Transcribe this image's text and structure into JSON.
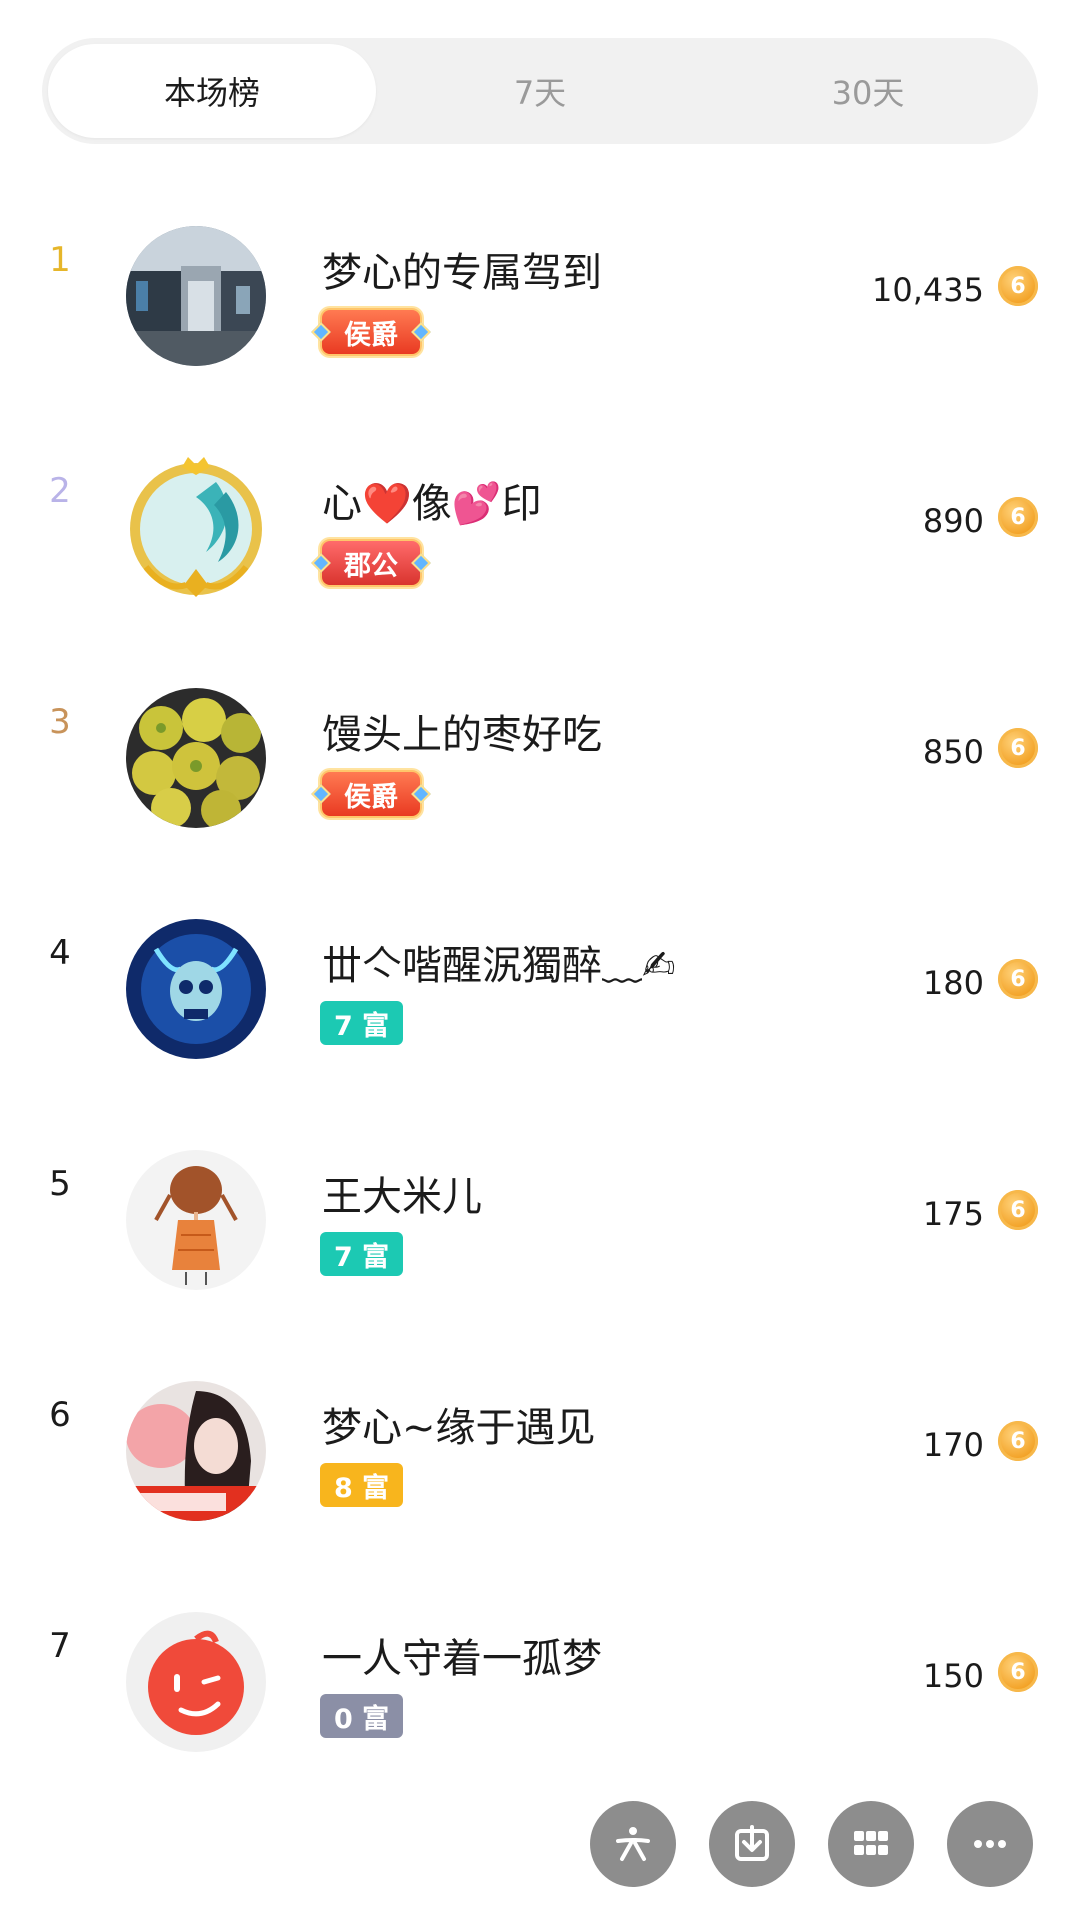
{
  "tabs": [
    {
      "label": "本场榜",
      "active": true
    },
    {
      "label": "7天",
      "active": false
    },
    {
      "label": "30天",
      "active": false
    }
  ],
  "rank_colors": {
    "1": "#e6b62a",
    "2": "#b9b3e8",
    "3": "#c8935a"
  },
  "coin_glyph": "6",
  "list": [
    {
      "rank": "1",
      "name": "梦心的专属驾到",
      "badge": "侯爵",
      "badge_type": "title",
      "score": "10,435",
      "avatar": "mall-photo"
    },
    {
      "rank": "2",
      "name": "心❤️像💕印",
      "badge": "郡公",
      "badge_type": "title",
      "score": "890",
      "avatar": "gold-frame-dragon"
    },
    {
      "rank": "3",
      "name": "馒头上的枣好吃",
      "badge": "侯爵",
      "badge_type": "title",
      "score": "850",
      "avatar": "fruit-photo"
    },
    {
      "rank": "4",
      "name": "丗亽喈醒泦獨醉﹏✍",
      "badge": "7 富",
      "badge_type": "wealth",
      "badge_color": "#1cc9b3",
      "score": "180",
      "avatar": "skull-art"
    },
    {
      "rank": "5",
      "name": "王大米儿",
      "badge": "7 富",
      "badge_type": "wealth",
      "badge_color": "#1cc9b3",
      "score": "175",
      "avatar": "girl-drawing"
    },
    {
      "rank": "6",
      "name": "梦心~缘于遇见",
      "badge": "8 富",
      "badge_type": "wealth",
      "badge_color": "#f8b51d",
      "score": "170",
      "avatar": "woman-photo"
    },
    {
      "rank": "7",
      "name": "一人守着一孤梦",
      "badge": "0 富",
      "badge_type": "wealth",
      "badge_color": "#8b8fa6",
      "score": "150",
      "avatar": "red-wink-face"
    }
  ],
  "toolbar": [
    {
      "name": "spark-icon"
    },
    {
      "name": "download-icon"
    },
    {
      "name": "grid-icon"
    },
    {
      "name": "more-icon"
    }
  ]
}
